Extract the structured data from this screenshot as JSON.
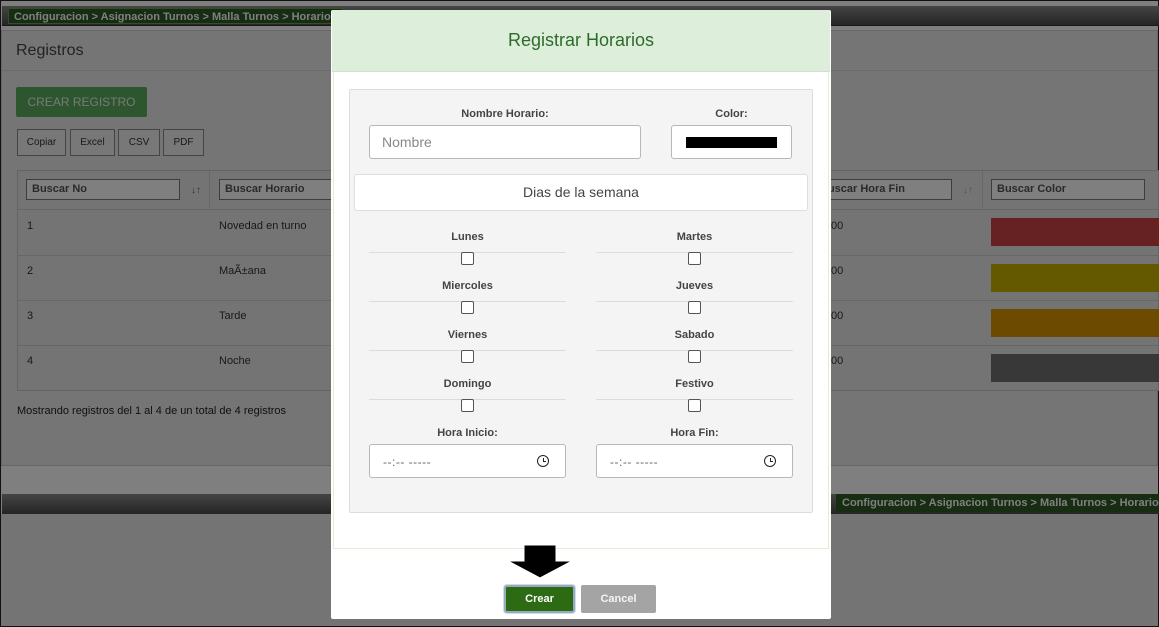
{
  "breadcrumb": {
    "top": "Configuracion > Asignacion Turnos > Malla Turnos > Horarios",
    "bottom": "Configuracion > Asignacion Turnos > Malla Turnos > Horarios"
  },
  "page": {
    "title": "Registros",
    "create_button": "CREAR REGISTRO"
  },
  "export_buttons": [
    "Copiar",
    "Excel",
    "CSV",
    "PDF"
  ],
  "table": {
    "search_placeholders": {
      "no": "Buscar No",
      "horario": "Buscar Horario",
      "hora_fin": "Buscar Hora Fin",
      "color": "Buscar Color"
    },
    "rows": [
      {
        "no": "1",
        "horario": "Novedad en turno",
        "hora_fin": "00",
        "color": "#cc4444"
      },
      {
        "no": "2",
        "horario": "MaÃ±ana",
        "hora_fin": "00",
        "color": "#c9b200"
      },
      {
        "no": "3",
        "horario": "Tarde",
        "hora_fin": "00",
        "color": "#d99500"
      },
      {
        "no": "4",
        "horario": "Noche",
        "hora_fin": "00",
        "color": "#707070"
      }
    ],
    "info": "Mostrando registros del 1 al 4 de un total de 4 registros"
  },
  "modal": {
    "title": "Registrar Horarios",
    "name_label": "Nombre Horario:",
    "name_placeholder": "Nombre",
    "color_label": "Color:",
    "color_value": "#000000",
    "days_heading": "Dias de la semana",
    "days": [
      "Lunes",
      "Martes",
      "Miercoles",
      "Jueves",
      "Viernes",
      "Sabado",
      "Domingo",
      "Festivo"
    ],
    "hora_inicio_label": "Hora Inicio:",
    "hora_fin_label": "Hora Fin:",
    "time_placeholder": "--:-- -----",
    "create_button": "Crear",
    "cancel_button": "Cancel"
  }
}
